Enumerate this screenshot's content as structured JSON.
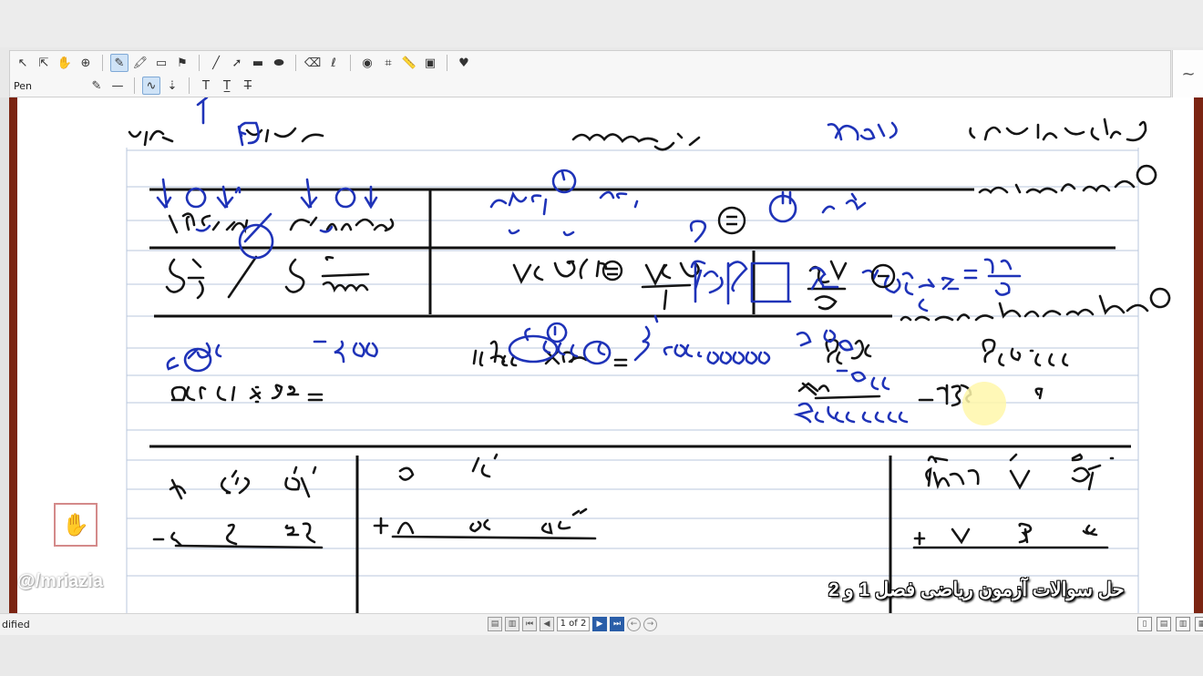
{
  "toolbar": {
    "row1_tools": [
      {
        "name": "select-arrow-icon",
        "glyph": "↖"
      },
      {
        "name": "select-text-icon",
        "glyph": "⇱"
      },
      {
        "name": "hand-pan-icon",
        "glyph": "✋"
      },
      {
        "name": "zoom-icon",
        "glyph": "⊕"
      },
      {
        "name": "pen-tool-icon",
        "glyph": "✎",
        "active": true
      },
      {
        "name": "highlighter-icon",
        "glyph": "🖍"
      },
      {
        "name": "textbox-icon",
        "glyph": "▭"
      },
      {
        "name": "stamp-icon",
        "glyph": "⚑"
      },
      {
        "name": "line-icon",
        "glyph": "╱"
      },
      {
        "name": "arrow-icon",
        "glyph": "➚"
      },
      {
        "name": "rectangle-icon",
        "glyph": "▬"
      },
      {
        "name": "ellipse-icon",
        "glyph": "⬬"
      },
      {
        "name": "eraser-icon",
        "glyph": "⌫"
      },
      {
        "name": "lasso-icon",
        "glyph": "ℓ"
      },
      {
        "name": "camera-icon",
        "glyph": "◉"
      },
      {
        "name": "crop-icon",
        "glyph": "⌗"
      },
      {
        "name": "ruler-icon",
        "glyph": "📏"
      },
      {
        "name": "insert-image-icon",
        "glyph": "▣"
      },
      {
        "name": "favorite-heart-icon",
        "glyph": "♥"
      }
    ],
    "tool_name": "Pen",
    "row2_tools": [
      {
        "name": "pen-color-icon",
        "glyph": "✎"
      },
      {
        "name": "line-style-icon",
        "glyph": "—"
      },
      {
        "name": "smooth-stroke-icon",
        "glyph": "∿",
        "active": true
      },
      {
        "name": "pressure-icon",
        "glyph": "⇣"
      },
      {
        "name": "text-bold-icon",
        "glyph": "T"
      },
      {
        "name": "text-underline-icon",
        "glyph": "T̲"
      },
      {
        "name": "text-strike-icon",
        "glyph": "T̶"
      }
    ],
    "right_glyph": "~"
  },
  "colors": {
    "ink_black": "#1a1a1a",
    "ink_blue": "#1f33b8",
    "page_border": "#7b2412",
    "rule_line": "#b9c7de"
  },
  "watermark": "@/mriazia",
  "caption": "حل سوالات آزمون ریاضی فصل 1 و 2",
  "status": {
    "left_text": "dified",
    "page_indicator": "1 of 2"
  }
}
